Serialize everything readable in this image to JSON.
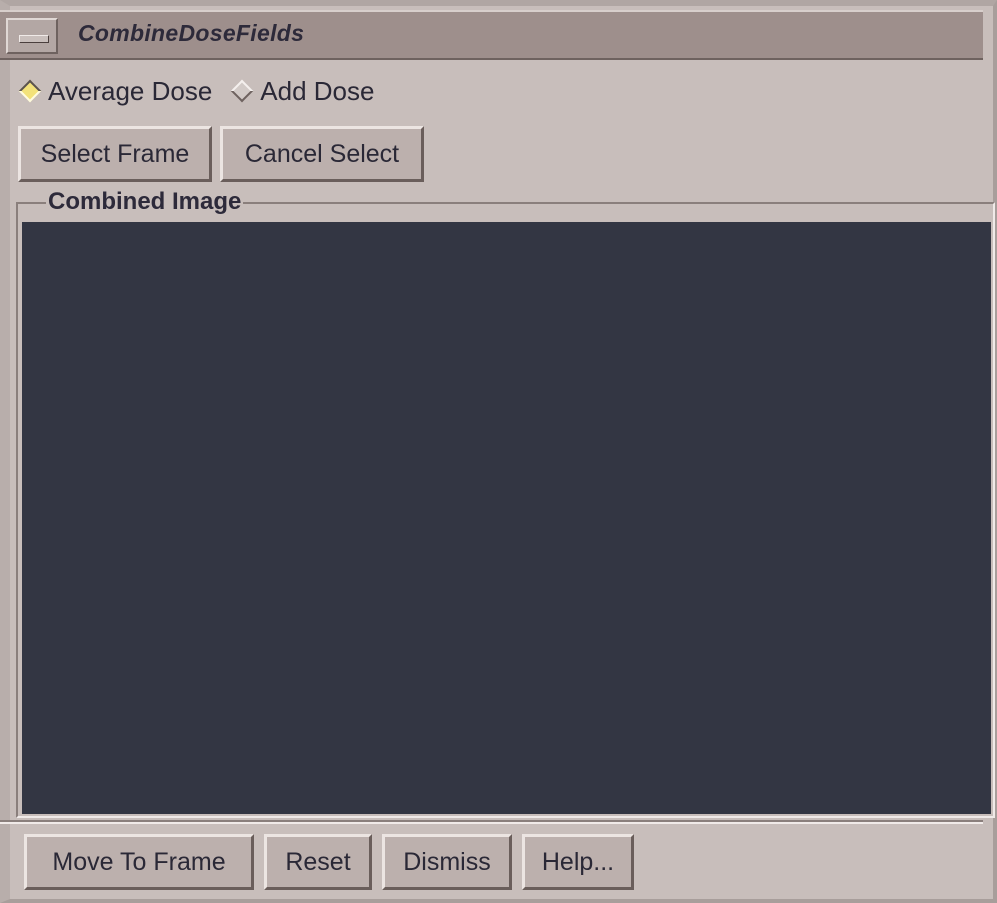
{
  "window": {
    "title": "CombineDoseFields"
  },
  "options": {
    "average_dose_label": "Average Dose",
    "add_dose_label": "Add Dose",
    "selected": "Average Dose"
  },
  "toolbar": {
    "select_frame_label": "Select Frame",
    "cancel_select_label": "Cancel Select"
  },
  "combined_image": {
    "label": "Combined Image",
    "background_color": "#333643"
  },
  "footer": {
    "move_to_frame_label": "Move To Frame",
    "reset_label": "Reset",
    "dismiss_label": "Dismiss",
    "help_label": "Help..."
  },
  "colors": {
    "window_bg": "#c8bebb",
    "titlebar_bg": "#9e8f8c",
    "radio_selected": "#f3e27a"
  }
}
